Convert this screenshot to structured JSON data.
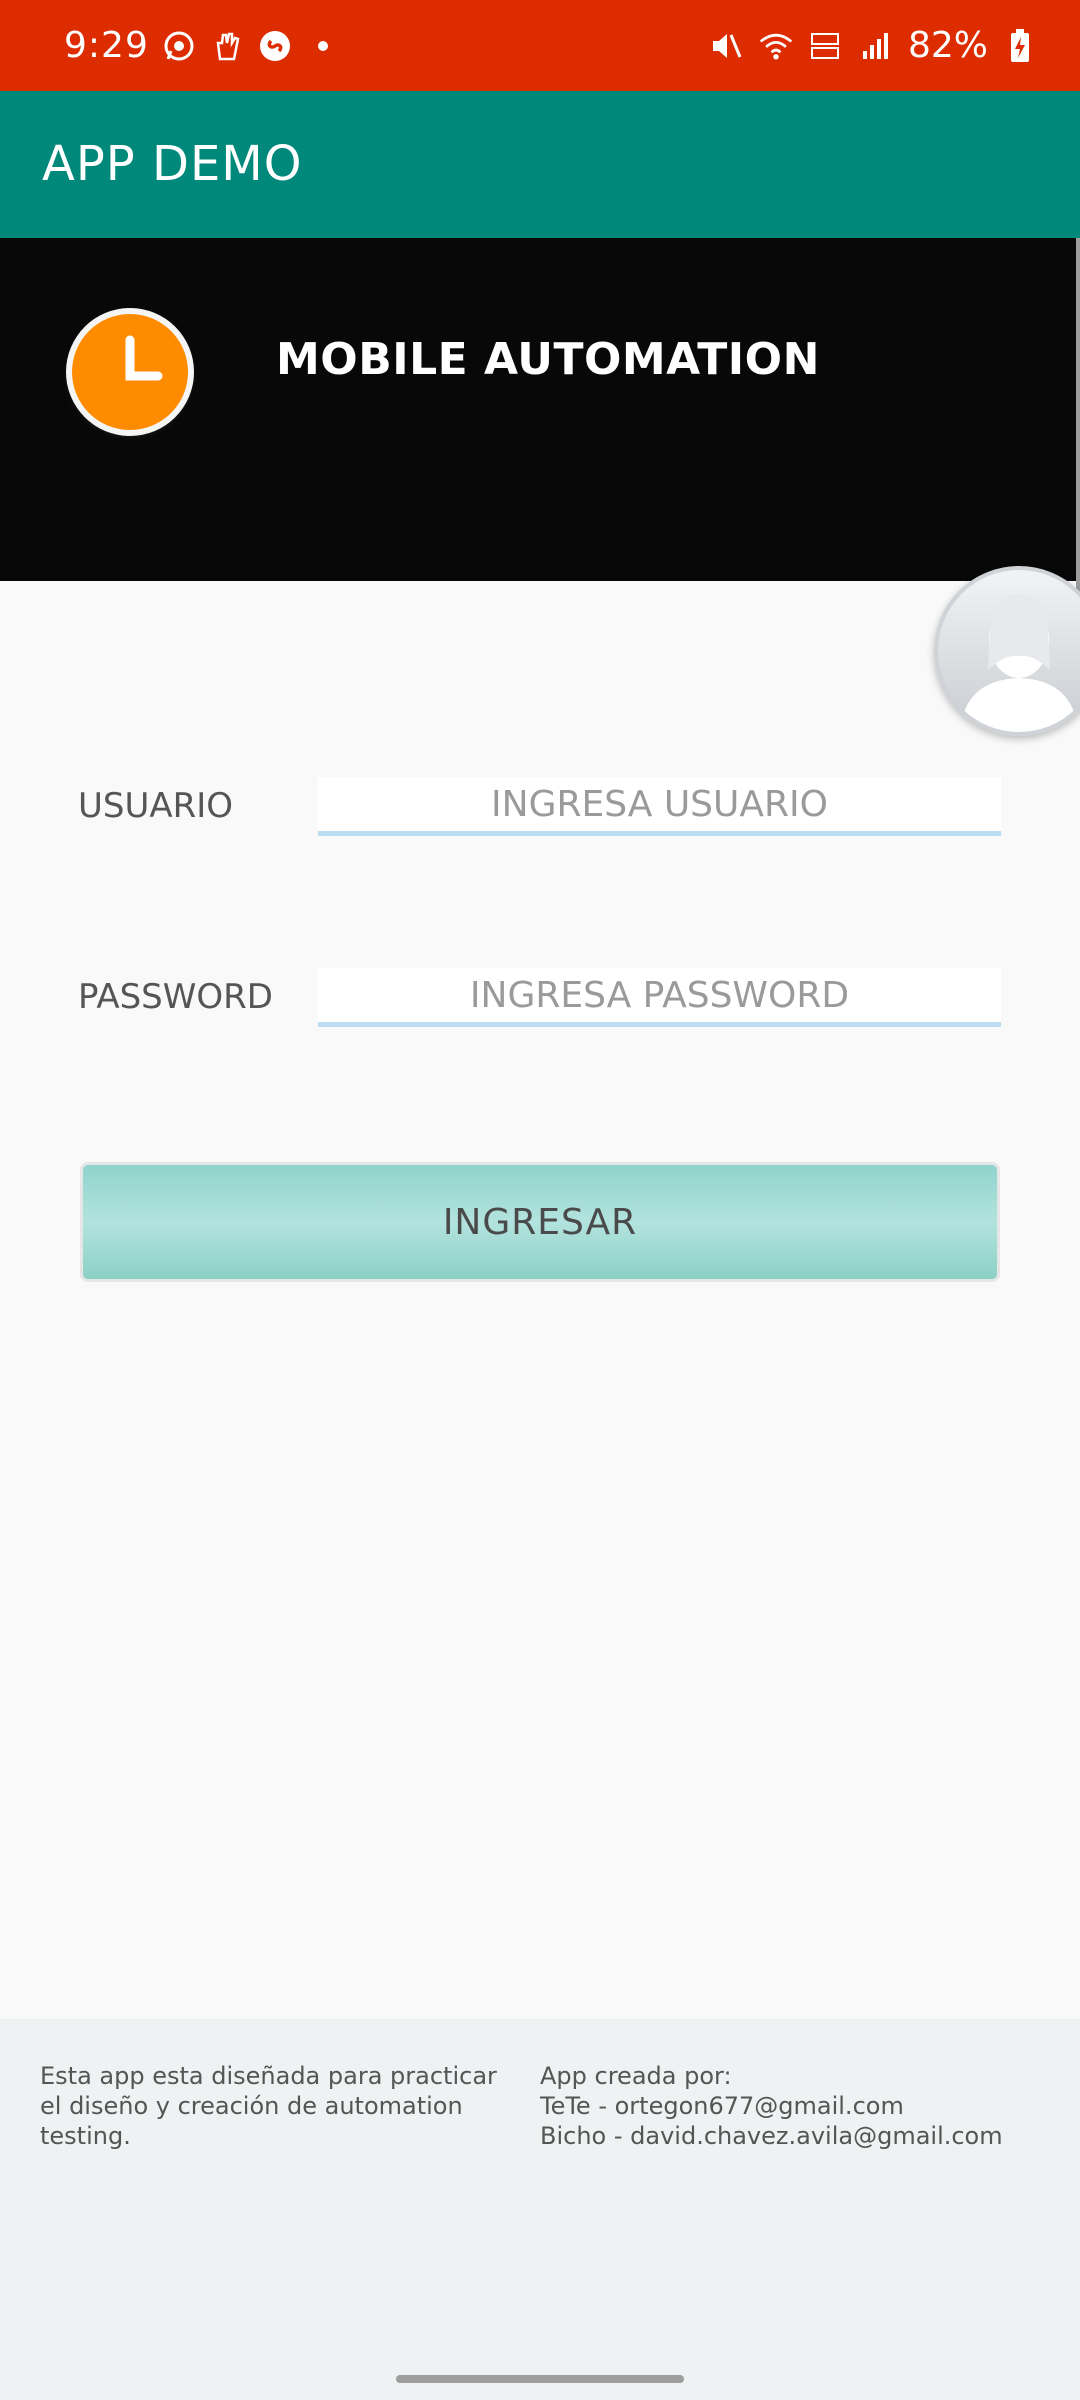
{
  "status_bar": {
    "time": "9:29",
    "battery": "82%",
    "background": "#dd2c00",
    "left_icons": [
      "whatsapp-icon",
      "hand-icon",
      "shazam-icon",
      "dot-icon"
    ],
    "right_icons": [
      "mute-icon",
      "wifi-icon",
      "volte-icon",
      "signal-icon",
      "battery-charging-icon"
    ]
  },
  "app_bar": {
    "title": "APP DEMO",
    "color": "#00897b"
  },
  "header": {
    "title": "MOBILE AUTOMATION",
    "logo": "clock-icon",
    "logo_color": "#ff8c00"
  },
  "form": {
    "user": {
      "label": "USUARIO",
      "placeholder": "INGRESA USUARIO",
      "value": ""
    },
    "password": {
      "label": "PASSWORD",
      "placeholder": "INGRESA PASSWORD",
      "value": ""
    },
    "submit_label": "INGRESAR"
  },
  "footer": {
    "description": "Esta app esta diseñada para practicar el diseño y creación de automation testing.",
    "credits_title": "App creada por:",
    "credit_1": "TeTe - ortegon677@gmail.com",
    "credit_2": "Bicho - david.chavez.avila@gmail.com"
  }
}
